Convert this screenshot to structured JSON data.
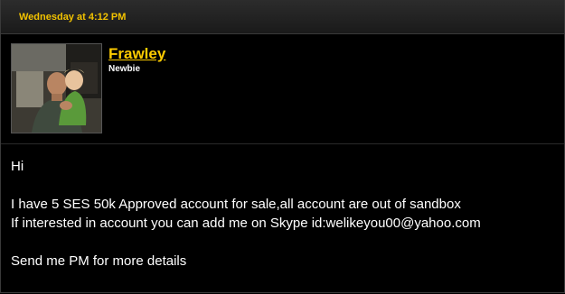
{
  "post": {
    "date": "Wednesday at 4:12 PM",
    "author": {
      "username": "Frawley",
      "title": "Newbie",
      "avatar_icon": "user-avatar-photo"
    },
    "message": {
      "line1": "Hi",
      "line2": "I have 5 SES 50k Approved account for sale,all account are out of sandbox",
      "line3": "If interested in account you can add me on Skype id:welikeyou00@yahoo.com",
      "line4": "Send me PM for more details"
    }
  },
  "colors": {
    "accent": "#ffcc00",
    "background": "#000000",
    "text": "#ffffff"
  }
}
